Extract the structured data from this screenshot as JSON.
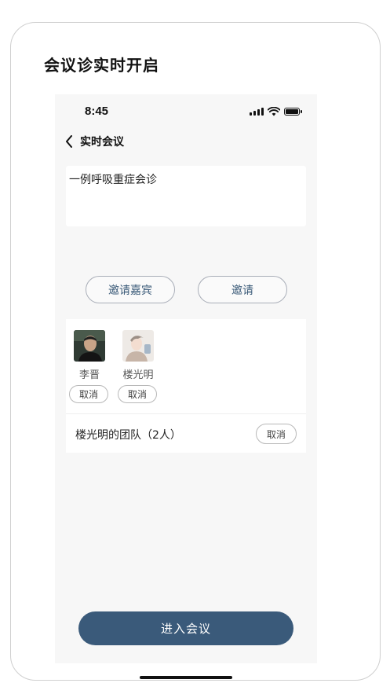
{
  "card": {
    "title": "会议诊实时开启"
  },
  "status_bar": {
    "time": "8:45"
  },
  "nav": {
    "back_icon": "chevron-left-icon",
    "title": "实时会议"
  },
  "topic": {
    "text": "一例呼吸重症会诊"
  },
  "actions": {
    "invite_guest_label": "邀请嘉宾",
    "invite_label": "邀请"
  },
  "members": [
    {
      "name": "李晋",
      "cancel_label": "取消",
      "avatar": "dark-portrait-photo"
    },
    {
      "name": "楼光明",
      "cancel_label": "取消",
      "avatar": "illustrated-portrait"
    }
  ],
  "team": {
    "label": "楼光明的团队（2人）",
    "cancel_label": "取消"
  },
  "enter_button": {
    "label": "进入会议"
  },
  "colors": {
    "primary": "#3a5a7a",
    "accent_text": "#3a5a78",
    "background": "#f7f7f7"
  }
}
